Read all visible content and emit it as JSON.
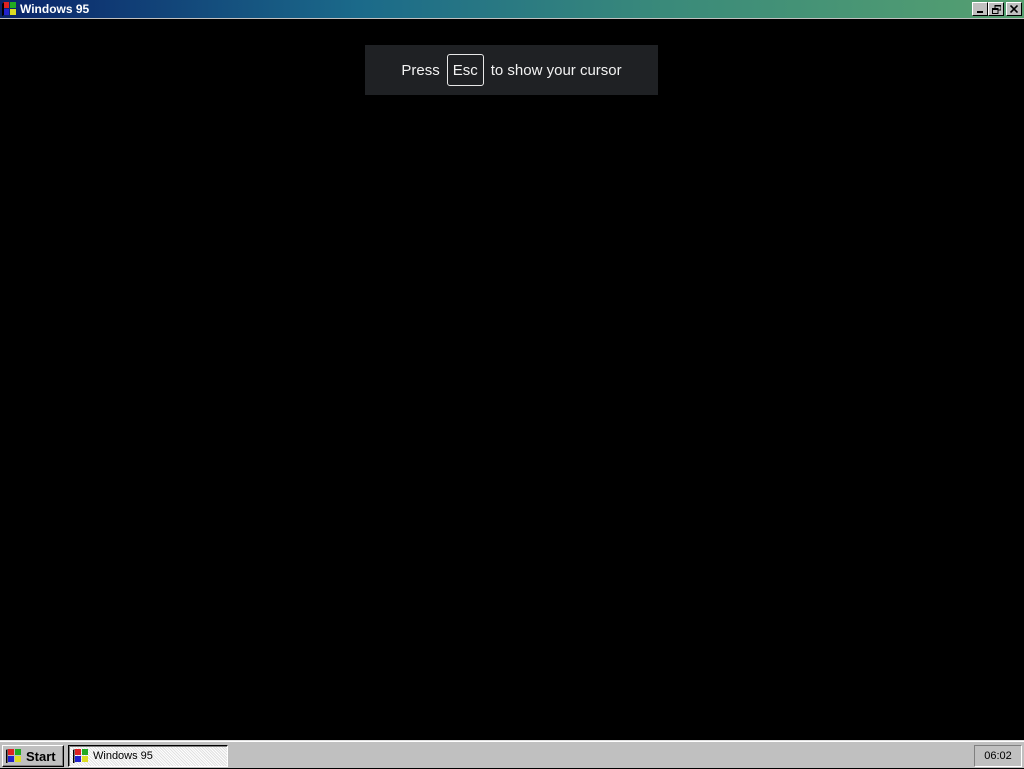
{
  "window": {
    "title": "Windows 95",
    "buttons": {
      "minimize": "minimize-icon",
      "restore": "restore-icon",
      "close": "close-icon"
    }
  },
  "overlay": {
    "prefix": "Press",
    "key": "Esc",
    "suffix": "to show your cursor"
  },
  "taskbar": {
    "start_label": "Start",
    "task_label": "Windows 95",
    "clock": "06:02"
  },
  "colors": {
    "titlebar_start": "#0a246a",
    "titlebar_end": "#56a070",
    "screen_bg": "#000000",
    "toast_bg": "#1f2124",
    "taskbar_bg": "#c0c0c0"
  }
}
